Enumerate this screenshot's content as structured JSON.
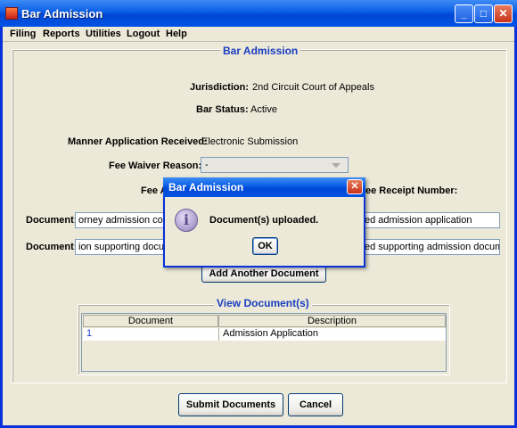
{
  "window": {
    "title": "Bar Admission"
  },
  "menu": [
    "Filing",
    "Reports",
    "Utilities",
    "Logout",
    "Help"
  ],
  "form": {
    "section_title": "Bar Admission",
    "jurisdiction_label": "Jurisdiction:",
    "jurisdiction_value": "2nd Circuit Court of Appeals",
    "bar_status_label": "Bar Status:",
    "bar_status_value": "Active",
    "manner_label": "Manner Application Received:",
    "manner_value": "Electronic Submission",
    "fee_waiver_label": "Fee Waiver Reason:",
    "fee_waiver_value": "-",
    "fee_amount_label_partial": "Fee A",
    "fee_receipt_label_partial": "ee Receipt Number:",
    "documents": [
      {
        "label": "Document:",
        "file_value": "orney admission corr",
        "desc_value": "ed admission application"
      },
      {
        "label": "Document:",
        "file_value": "ion supporting docur",
        "desc_value": "ed supporting admission docum"
      }
    ],
    "add_document_button": "Add Another Document"
  },
  "view_documents": {
    "title": "View Document(s)",
    "columns": [
      "Document",
      "Description"
    ],
    "rows": [
      {
        "document": "1",
        "description": "Admission Application"
      }
    ]
  },
  "actions": {
    "submit": "Submit Documents",
    "cancel": "Cancel"
  },
  "dialog": {
    "title": "Bar Admission",
    "message": "Document(s) uploaded.",
    "ok": "OK",
    "icon": "info-icon"
  },
  "colors": {
    "accent": "#1a3ec0",
    "titlebar": "#0a5de6"
  }
}
